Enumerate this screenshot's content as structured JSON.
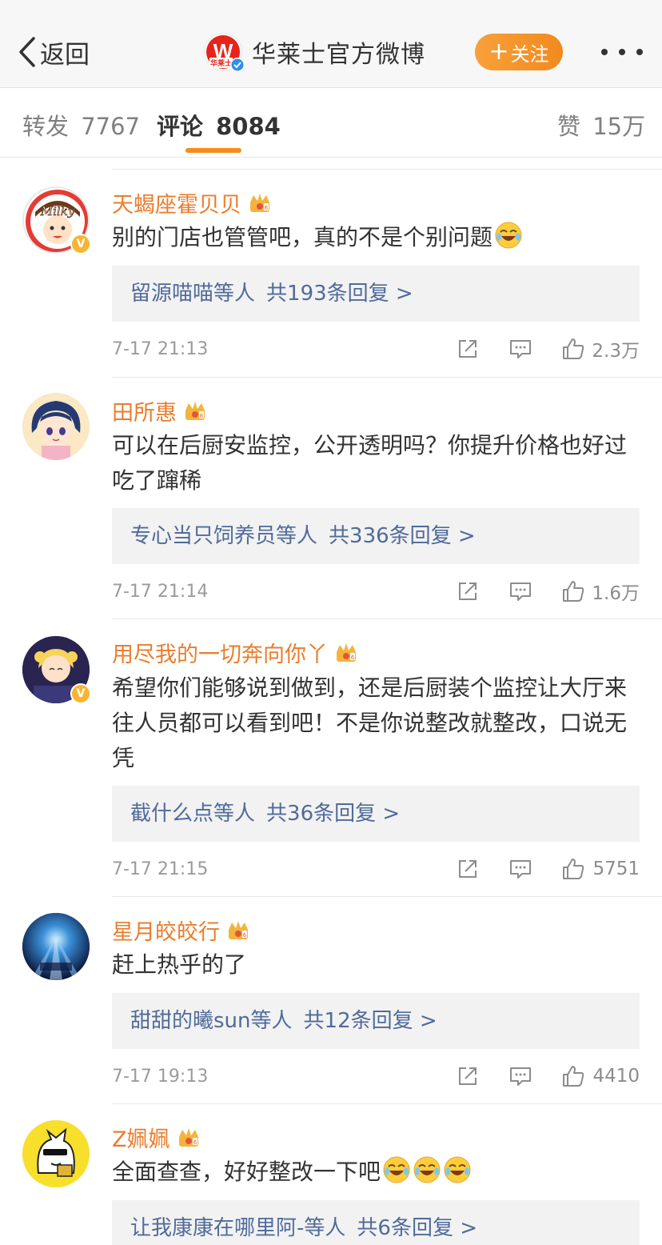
{
  "navbar": {
    "back_label": "返回",
    "account_name": "华莱士官方微博",
    "logo_letter": "W",
    "logo_text": "华莱士",
    "follow_label": "关注",
    "follow_plus": "+"
  },
  "tabs": {
    "repost_label": "转发",
    "repost_count": "7767",
    "comment_label": "评论",
    "comment_count": "8084",
    "like_label": "赞",
    "like_count": "15万"
  },
  "colors": {
    "accent": "#f78c1c",
    "username": "#ea7d2c",
    "link": "#506b9a"
  },
  "comments": [
    {
      "username": "天蝎座霍贝贝",
      "avatar_text": "Milky",
      "verified": true,
      "text": "别的门店也管管吧，真的不是个别问题",
      "emojis": [
        "laughing-tears"
      ],
      "reply_who": "留源喵喵",
      "reply_etc": "等人",
      "reply_count": "共193条回复 >",
      "time": "7-17 21:13",
      "likes": "2.3万"
    },
    {
      "username": "田所惠",
      "avatar_text": "",
      "verified": false,
      "text": "可以在后厨安监控，公开透明吗？你提升价格也好过吃了蹿稀",
      "emojis": [],
      "reply_who": "专心当只饲养员",
      "reply_etc": "等人",
      "reply_count": "共336条回复 >",
      "time": "7-17 21:14",
      "likes": "1.6万"
    },
    {
      "username": "用尽我的一切奔向你丫",
      "avatar_text": "",
      "verified": true,
      "text": "希望你们能够说到做到，还是后厨装个监控让大厅来往人员都可以看到吧！不是你说整改就整改，口说无凭",
      "emojis": [],
      "reply_who": "截什么点",
      "reply_etc": "等人",
      "reply_count": "共36条回复 >",
      "time": "7-17 21:15",
      "likes": "5751"
    },
    {
      "username": "星月皎皎行",
      "avatar_text": "",
      "verified": false,
      "text": "赶上热乎的了",
      "emojis": [],
      "reply_who": "甜甜的曦sun",
      "reply_etc": "等人",
      "reply_count": "共12条回复 >",
      "time": "7-17 19:13",
      "likes": "4410"
    },
    {
      "username": "Z姵姵",
      "avatar_text": "",
      "verified": false,
      "text": "全面查查，好好整改一下吧",
      "emojis": [
        "laughing-tears",
        "laughing-tears",
        "laughing-tears"
      ],
      "reply_who": "让我康康在哪里阿-",
      "reply_etc": "等人",
      "reply_count": "共6条回复 >",
      "time": "",
      "likes": ""
    }
  ]
}
